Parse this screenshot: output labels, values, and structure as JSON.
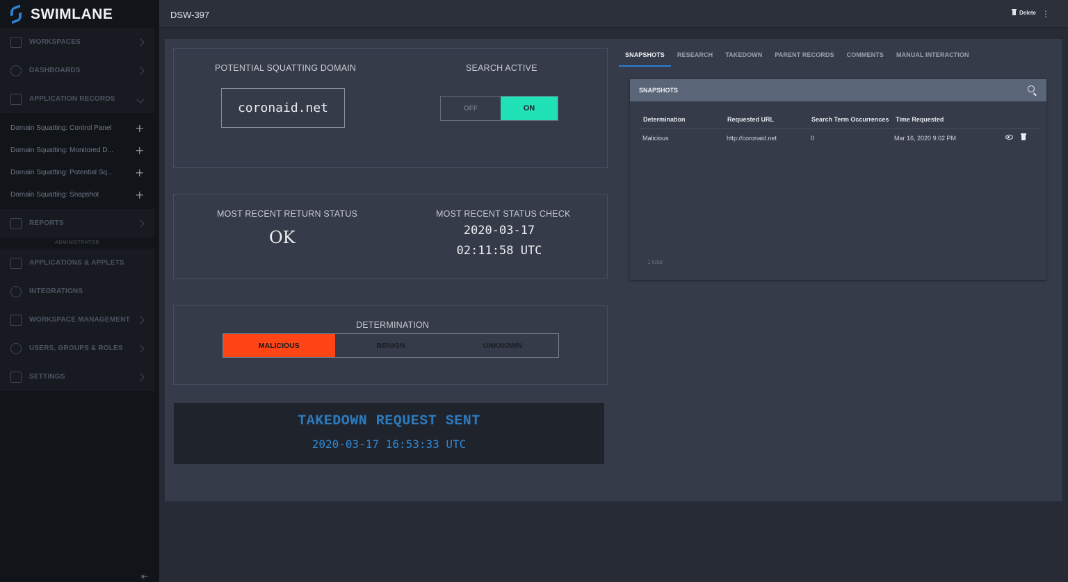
{
  "app": {
    "name": "SWIMLANE"
  },
  "sidebar": {
    "nav_top": [
      {
        "label": "WORKSPACES",
        "icon": "grid-icon"
      },
      {
        "label": "DASHBOARDS",
        "icon": "gauge-icon"
      },
      {
        "label": "APPLICATION RECORDS",
        "icon": "list-icon"
      }
    ],
    "records": [
      {
        "label": "Domain Squatting: Control Panel"
      },
      {
        "label": "Domain Squatting: Monitored D..."
      },
      {
        "label": "Domain Squatting: Potential Sq..."
      },
      {
        "label": "Domain Squatting: Snapshot"
      }
    ],
    "reports_label": "REPORTS",
    "admin_section_label": "ADMINISTRATOR",
    "nav_admin": [
      {
        "label": "APPLICATIONS & APPLETS",
        "icon": "apps-icon"
      },
      {
        "label": "INTEGRATIONS",
        "icon": "cube-icon"
      },
      {
        "label": "WORKSPACE MANAGEMENT",
        "icon": "layout-icon"
      },
      {
        "label": "USERS, GROUPS & ROLES",
        "icon": "users-icon"
      },
      {
        "label": "SETTINGS",
        "icon": "gear-icon"
      }
    ],
    "collapse_glyph": "⇤"
  },
  "header": {
    "record_id": "DSW-397",
    "delete_label": "Delete",
    "more_glyph": "⋮"
  },
  "domain_card": {
    "title": "POTENTIAL SQUATTING DOMAIN",
    "domain": "coronaid.net"
  },
  "search_card": {
    "title": "SEARCH ACTIVE",
    "off_label": "OFF",
    "on_label": "ON",
    "value": "ON"
  },
  "status_card": {
    "return_title": "MOST RECENT RETURN STATUS",
    "return_value": "OK",
    "check_title": "MOST RECENT STATUS CHECK",
    "check_date": "2020-03-17",
    "check_time": "02:11:58 UTC"
  },
  "determination": {
    "title": "DETERMINATION",
    "options": [
      "MALICIOUS",
      "BENIGN",
      "UNKNOWN"
    ],
    "selected": "MALICIOUS"
  },
  "takedown": {
    "title": "TAKEDOWN REQUEST SENT",
    "date": "2020-03-17 16:53:33 UTC"
  },
  "tabs": [
    {
      "label": "SNAPSHOTS",
      "active": true
    },
    {
      "label": "RESEARCH",
      "active": false
    },
    {
      "label": "TAKEDOWN",
      "active": false
    },
    {
      "label": "PARENT RECORDS",
      "active": false
    },
    {
      "label": "COMMENTS",
      "active": false
    },
    {
      "label": "MANUAL INTERACTION",
      "active": false
    }
  ],
  "snapshots": {
    "title": "SNAPSHOTS",
    "columns": [
      "Determination",
      "Requested URL",
      "Search Term Occurrences",
      "Time Requested"
    ],
    "rows": [
      {
        "determination": "Malicious",
        "url": "http://coronaid.net",
        "occurrences": "0",
        "time": "Mar 16, 2020 9:02 PM"
      }
    ],
    "total": "1 total"
  },
  "colors": {
    "sidebar_bg": "#111419",
    "page_bg": "#262b35",
    "panel_bg": "#353b48",
    "toggle_on": "#20e2b6",
    "malicious": "#ff4515",
    "takedown_text": "#2d7bbf",
    "tab_underline": "#2d7fd4"
  }
}
